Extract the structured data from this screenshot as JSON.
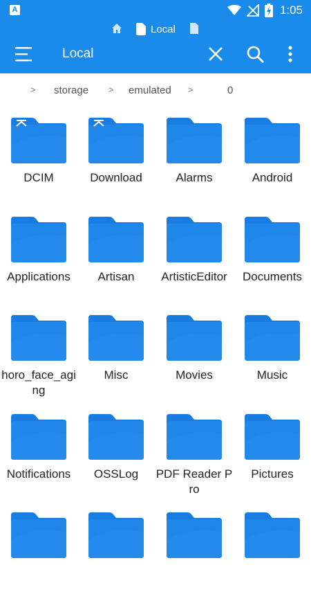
{
  "status_bar": {
    "app_icon": "A",
    "time": "1:05",
    "icons": [
      "wifi-icon",
      "no-signal-icon",
      "battery-charging-icon"
    ]
  },
  "toolbar": {
    "tab_label": "Local",
    "title": "Local",
    "icons": [
      "home-icon",
      "file-icon",
      "document-icon",
      "menu-icon",
      "close-icon",
      "search-icon",
      "more-vert-icon"
    ]
  },
  "breadcrumb": {
    "separator": ">",
    "items": [
      "storage",
      "emulated",
      "0"
    ]
  },
  "colors": {
    "accent": "#1a8bea",
    "folder": "#1f86ea",
    "folder_tab": "#1a7be0"
  },
  "folders": [
    {
      "name": "DCIM",
      "special": true
    },
    {
      "name": "Download",
      "special": true
    },
    {
      "name": "Alarms",
      "special": false
    },
    {
      "name": "Android",
      "special": false
    },
    {
      "name": "Applications",
      "special": false
    },
    {
      "name": "Artisan",
      "special": false
    },
    {
      "name": "ArtisticEditor",
      "special": false
    },
    {
      "name": "Documents",
      "special": false
    },
    {
      "name": "horo_face_aging",
      "special": false
    },
    {
      "name": "Misc",
      "special": false
    },
    {
      "name": "Movies",
      "special": false
    },
    {
      "name": "Music",
      "special": false
    },
    {
      "name": "Notifications",
      "special": false
    },
    {
      "name": "OSSLog",
      "special": false
    },
    {
      "name": "PDF Reader Pro",
      "special": false
    },
    {
      "name": "Pictures",
      "special": false
    },
    {
      "name": "",
      "special": false
    },
    {
      "name": "",
      "special": false
    },
    {
      "name": "",
      "special": false
    },
    {
      "name": "",
      "special": false
    }
  ]
}
